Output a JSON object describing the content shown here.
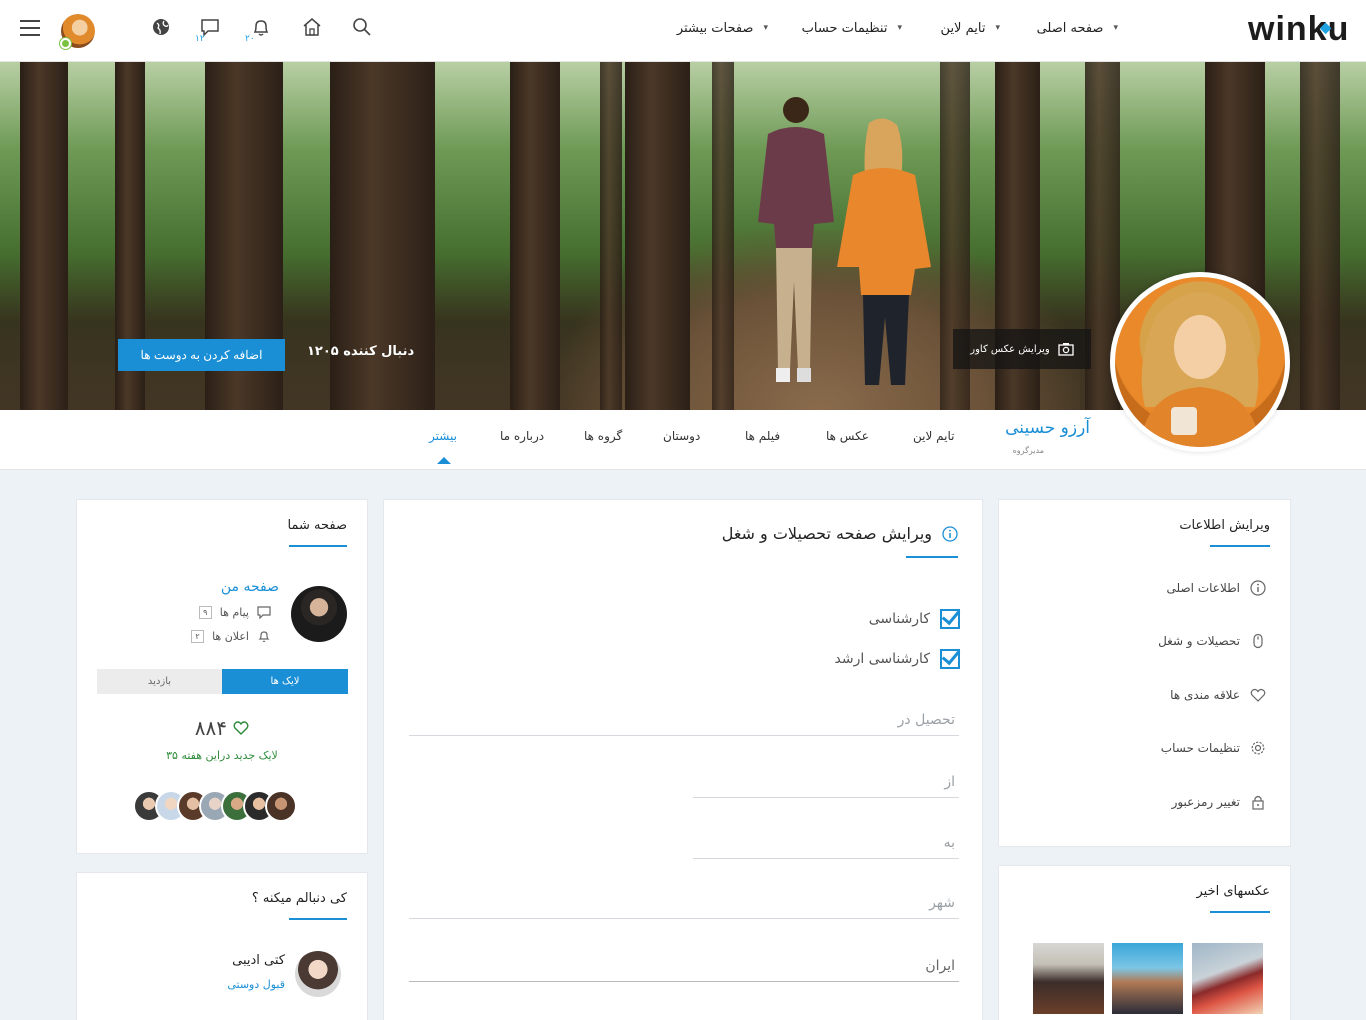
{
  "header": {
    "logo": "winku",
    "menu": [
      {
        "label": "صفحه اصلی"
      },
      {
        "label": "تایم لاین"
      },
      {
        "label": "تنظیمات حساب"
      },
      {
        "label": "صفحات بیشتر"
      }
    ],
    "messages_count": "۱۲",
    "notifications_count": "۲۰",
    "icons": [
      "search-icon",
      "home-icon",
      "bell-icon",
      "chat-icon",
      "globe-icon",
      "menu-icon"
    ]
  },
  "cover": {
    "followers": "۱۲۰۵ دنبال کننده",
    "add_friend": "اضافه کردن به دوست ها",
    "edit_cover": "ویرایش عکس کاور"
  },
  "profile": {
    "name": "آرزو حسینی",
    "role": "مدیرگروه",
    "tabs": [
      "تایم لاین",
      "عکس ها",
      "فیلم ها",
      "دوستان",
      "گروه ها",
      "درباره ما",
      "بیشتر"
    ],
    "active_tab": "بیشتر"
  },
  "edit_info": {
    "title": "ویرایش اطلاعات",
    "items": [
      {
        "label": "اطلاعات اصلی",
        "icon": "info-icon"
      },
      {
        "label": "تحصیلات و شغل",
        "icon": "mouse-icon"
      },
      {
        "label": "علاقه مندی ها",
        "icon": "heart-icon"
      },
      {
        "label": "تنظیمات حساب",
        "icon": "gear-icon"
      },
      {
        "label": "تغییر رمزعبور",
        "icon": "lock-icon"
      }
    ]
  },
  "recent_photos": {
    "title": "عکسهای اخیر"
  },
  "form": {
    "title": "ویرایش صفحه تحصیلات و شغل",
    "checkboxes": [
      {
        "label": "کارشناسی",
        "checked": true
      },
      {
        "label": "کارشناسی ارشد",
        "checked": true
      }
    ],
    "fields": {
      "study_in": "تحصیل در",
      "from": "از",
      "to": "به",
      "city": "شهر",
      "country": "ایران"
    }
  },
  "your_page": {
    "title": "صفحه شما",
    "my_page": "صفحه من",
    "messages_label": "پیام ها",
    "messages_count": "۹",
    "notifications_label": "اعلان ها",
    "notifications_count": "۲",
    "likes_tab": "لایک ها",
    "visits_tab": "بازدید",
    "likes_total": "۸۸۴",
    "likes_week": "۳۵ لایک جدید دراین هفته"
  },
  "who_follows": {
    "title": "کی دنبالم میکنه ؟",
    "people": [
      {
        "name": "کتی ادیبی",
        "action": "قبول دوستی"
      }
    ]
  },
  "colors": {
    "accent": "#1a8fd6",
    "online": "#7cc242",
    "likes_week": "#2e8b3a"
  }
}
